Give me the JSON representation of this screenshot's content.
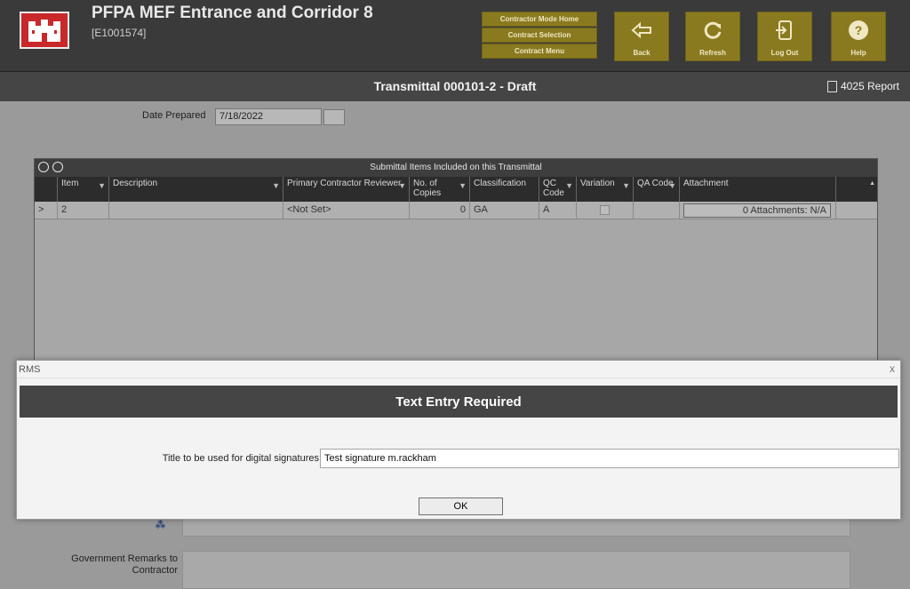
{
  "header": {
    "project_title": "PFPA MEF Entrance and Corridor 8",
    "project_id": "[E1001574]",
    "mode_buttons": [
      "Contractor Mode Home",
      "Contract Selection",
      "Contract Menu"
    ],
    "toolbar": {
      "back": "Back",
      "refresh": "Refresh",
      "logout": "Log Out",
      "help": "Help"
    }
  },
  "page": {
    "title": "Transmittal 000101-2 - Draft",
    "report_label": "4025 Report"
  },
  "form": {
    "date_label": "Date Prepared",
    "date_value": "7/18/2022",
    "remarks_label": "Government Remarks to Contractor"
  },
  "grid": {
    "caption": "Submittal Items Included on this Transmittal",
    "columns": [
      "Item",
      "Description",
      "Primary Contractor Reviewer",
      "No. of Copies",
      "Classification",
      "QC Code",
      "Variation",
      "QA Code",
      "Attachment"
    ],
    "rows": [
      {
        "selector": ">",
        "item": "2",
        "description": "",
        "reviewer": "<Not Set>",
        "copies": "0",
        "classification": "GA",
        "qc_code": "A",
        "variation": false,
        "qa_code": "",
        "attachment": "0 Attachments: N/A"
      }
    ]
  },
  "modal": {
    "window_title": "RMS",
    "close": "x",
    "heading": "Text Entry Required",
    "field_label": "Title to be used for digital signatures",
    "field_value": "Test signature m.rackham",
    "ok_label": "OK"
  },
  "colors": {
    "header_bg": "#3a3a3a",
    "gold_button": "#8a7a1f",
    "title_bar": "#454545",
    "logo_red": "#c8282a"
  }
}
